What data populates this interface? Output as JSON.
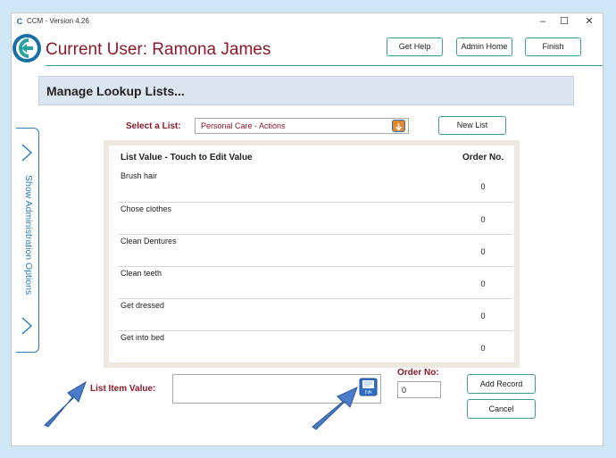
{
  "window": {
    "title": "CCM - Version 4.26",
    "controls": {
      "minimize": "–",
      "maximize": "☐",
      "close": "✕"
    }
  },
  "header": {
    "user_title": "Current User: Ramona James",
    "buttons": {
      "help": "Get Help",
      "admin_home": "Admin Home",
      "finish": "Finish"
    }
  },
  "page": {
    "title": "Manage Lookup Lists..."
  },
  "side_panel": {
    "label": "Show Administration Options"
  },
  "selector": {
    "label": "Select a List:",
    "value": "Personal Care - Actions",
    "new_list_label": "New List"
  },
  "list": {
    "columns": {
      "value": "List Value - Touch to Edit Value",
      "order": "Order No."
    },
    "rows": [
      {
        "value": "Brush hair",
        "order": "0"
      },
      {
        "value": "Chose clothes",
        "order": "0"
      },
      {
        "value": "Clean Dentures",
        "order": "0"
      },
      {
        "value": "Clean teeth",
        "order": "0"
      },
      {
        "value": "Get dressed",
        "order": "0"
      },
      {
        "value": "Get into bed",
        "order": "0"
      }
    ]
  },
  "entry": {
    "item_label": "List Item Value:",
    "item_value": "",
    "edit_icon_text": "Edit",
    "order_label": "Order No:",
    "order_value": "0",
    "add_label": "Add Record",
    "cancel_label": "Cancel"
  },
  "colors": {
    "accent_teal": "#3a9e92",
    "title_maroon": "#8b1a2b",
    "side_blue": "#2a7fb8",
    "arrow_blue": "#4a7cc9"
  }
}
